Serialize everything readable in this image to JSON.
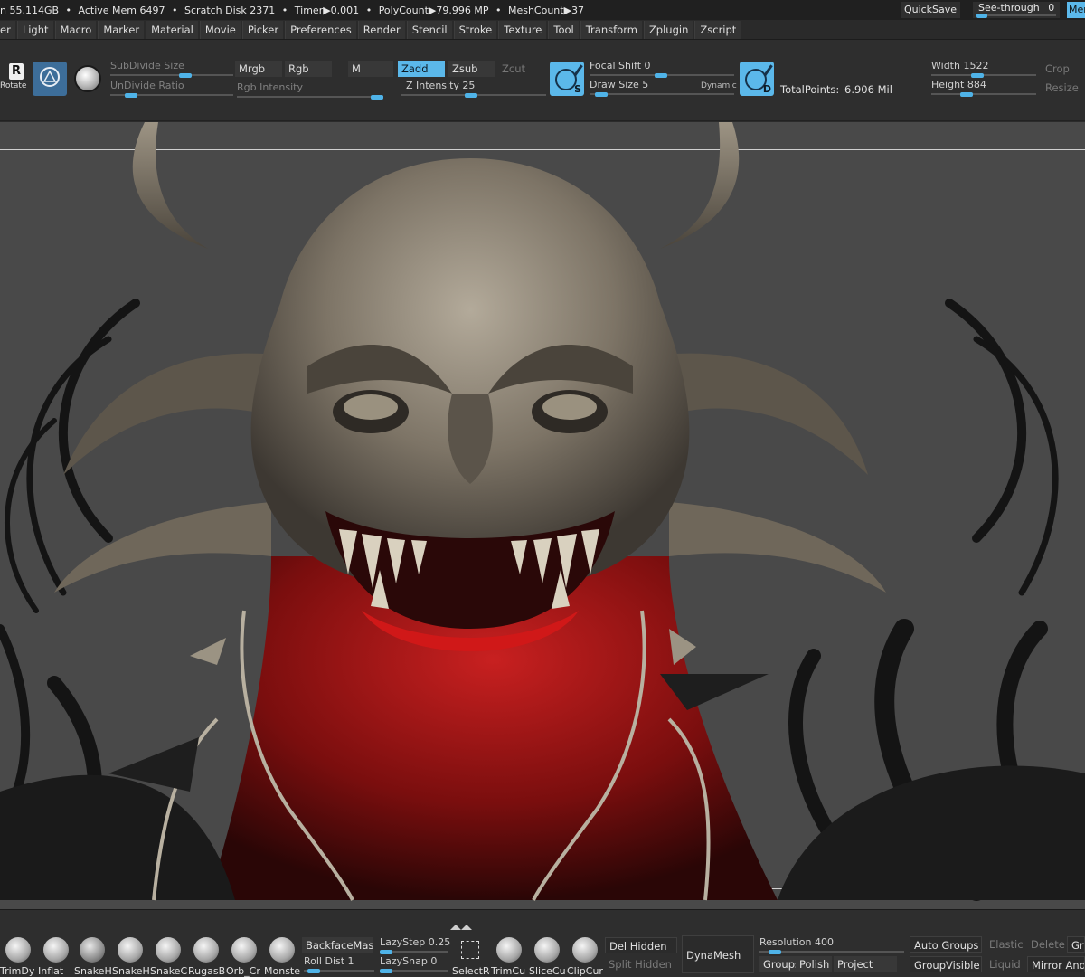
{
  "status": {
    "free_mem": "n 55.114GB",
    "active_mem": "Active Mem 6497",
    "scratch_disk": "Scratch Disk 2371",
    "timer": "Timer▶0.001",
    "polycount": "PolyCount▶79.996 MP",
    "meshcount": "MeshCount▶37",
    "quicksave": "QuickSave",
    "see_through_label": "See-through",
    "see_through_value": "0",
    "menus_tab": "Menus"
  },
  "menus": [
    "er",
    "Light",
    "Macro",
    "Marker",
    "Material",
    "Movie",
    "Picker",
    "Preferences",
    "Render",
    "Stencil",
    "Stroke",
    "Texture",
    "Tool",
    "Transform",
    "Zplugin",
    "Zscript"
  ],
  "shelf": {
    "rotate_label": "Rotate",
    "rotate_letter": "R",
    "subdivide_size": "SubDivide Size",
    "undivide_ratio": "UnDivide Ratio",
    "mrgb": "Mrgb",
    "rgb": "Rgb",
    "m": "M",
    "rgb_intensity": "Rgb Intensity",
    "zadd": "Zadd",
    "zsub": "Zsub",
    "zcut": "Zcut",
    "z_intensity": "Z Intensity 25",
    "focal_shift": "Focal Shift 0",
    "draw_size": "Draw Size 5",
    "dynamic": "Dynamic",
    "brush_s_letter": "S",
    "brush_d_letter": "D",
    "total_points_label": "TotalPoints:",
    "total_points_value": "6.906 Mil",
    "width": "Width 1522",
    "height": "Height 884",
    "crop": "Crop",
    "resize": "Resize"
  },
  "bottom": {
    "brushes": [
      "TrimDy",
      "Inflat",
      "SnakeH",
      "SnakeH",
      "SnakeC",
      "RugasB",
      "Orb_Cr",
      "Monste"
    ],
    "backface_mask": "BackfaceMask",
    "roll_dist": "Roll Dist 1",
    "lazy_step": "LazyStep 0.25",
    "lazy_snap": "LazySnap 0",
    "tools": [
      "SelectRe",
      "TrimCu",
      "SliceCu",
      "ClipCur"
    ],
    "del_hidden": "Del Hidden",
    "split_hidden": "Split Hidden",
    "dynamesh": "DynaMesh",
    "resolution": "Resolution 400",
    "groups": "Groups",
    "polish": "Polish",
    "project": "Project",
    "auto_groups": "Auto Groups",
    "group_visible": "GroupVisible",
    "elastic": "Elastic",
    "liquid": "Liquid",
    "delete": "Delete",
    "mirror_and": "Mirror And",
    "gro": "Gro"
  },
  "colors": {
    "accent": "#5bb8ea",
    "viewport_bg": "#494949",
    "shelf_bg": "#2e2e2e",
    "creature_base": "#8a8070",
    "creature_red": "#9a1414"
  }
}
